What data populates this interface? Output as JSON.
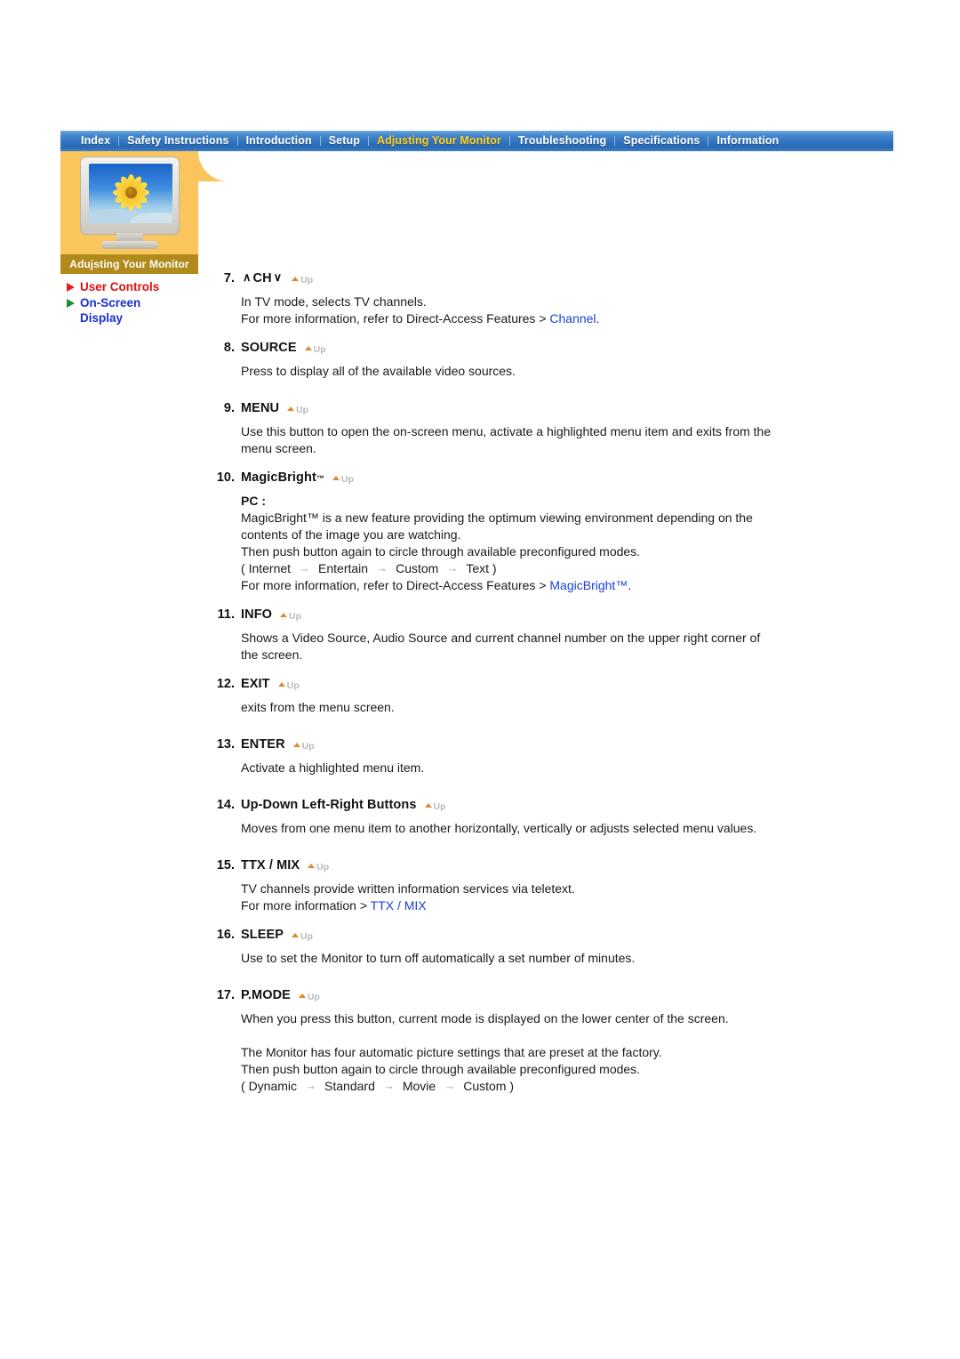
{
  "nav": {
    "items": [
      {
        "label": "Index",
        "active": false
      },
      {
        "label": "Safety Instructions",
        "active": false
      },
      {
        "label": "Introduction",
        "active": false
      },
      {
        "label": "Setup",
        "active": false
      },
      {
        "label": "Adjusting Your Monitor",
        "active": true
      },
      {
        "label": "Troubleshooting",
        "active": false
      },
      {
        "label": "Specifications",
        "active": false
      },
      {
        "label": "Information",
        "active": false
      }
    ],
    "active_color": "#ffcf1f",
    "bar_color": "#2f73c0"
  },
  "sidebar": {
    "card_caption": "Adujsting Your Monitor",
    "card_color": "#fbc55d",
    "caption_color": "#b08a1b",
    "thumbnail_icon": "monitor-sunflower-image",
    "links": [
      {
        "label": "User Controls",
        "color": "#e01010",
        "bullet_color": "#e01f1f"
      },
      {
        "label": "On-Screen Display",
        "color": "#1a2fd0",
        "bullet_color": "#15912b"
      }
    ]
  },
  "up_label": "Up",
  "content": {
    "items": [
      {
        "num": "7.",
        "title": "CH",
        "prefix_chevron": "∧",
        "suffix_chevron": "∨",
        "lines": [
          {
            "text": "In TV mode, selects TV channels."
          },
          {
            "text": "For more information, refer to Direct-Access Features > ",
            "link": "Channel",
            "after": "."
          }
        ]
      },
      {
        "num": "8.",
        "title": "SOURCE",
        "lines": [
          {
            "text": "Press to display all of the available video sources."
          }
        ]
      },
      {
        "num": "9.",
        "title": "MENU",
        "lines": [
          {
            "text": "Use this button to open the on-screen menu, activate a highlighted menu item and exits from the"
          },
          {
            "text": "menu screen."
          }
        ]
      },
      {
        "num": "10.",
        "title": "MagicBright",
        "trademark": "™",
        "sub_label": "PC :",
        "lines": [
          {
            "text": "MagicBright™ is a new feature providing the optimum viewing environment depending on the"
          },
          {
            "text": "contents of the image you are watching."
          },
          {
            "text": "Then push button again to circle through available preconfigured modes."
          }
        ],
        "mode_sequence": {
          "open": "(",
          "modes": [
            "Internet",
            "Entertain",
            "Custom",
            "Text"
          ],
          "close": ")",
          "arrow": "→"
        },
        "footer": {
          "text": "For more information, refer to Direct-Access Features > ",
          "link": "MagicBright™",
          "after": "."
        }
      },
      {
        "num": "11.",
        "title": "INFO",
        "lines": [
          {
            "text": "Shows a Video Source, Audio Source and current channel number on the upper right corner of"
          },
          {
            "text": "the screen."
          }
        ]
      },
      {
        "num": "12.",
        "title": "EXIT",
        "lines": [
          {
            "text": "exits from the menu screen."
          }
        ]
      },
      {
        "num": "13.",
        "title": "ENTER",
        "lines": [
          {
            "text": "Activate a highlighted menu item."
          }
        ]
      },
      {
        "num": "14.",
        "title": "Up-Down Left-Right Buttons",
        "lines": [
          {
            "text": "Moves from one menu item to another horizontally, vertically or adjusts selected menu values."
          }
        ]
      },
      {
        "num": "15.",
        "title": "TTX / MIX",
        "lines": [
          {
            "text": "TV channels provide written information services via teletext."
          },
          {
            "text": "For more information > ",
            "link": "TTX / MIX",
            "after": ""
          }
        ]
      },
      {
        "num": "16.",
        "title": "SLEEP",
        "lines": [
          {
            "text": "Use to set the Monitor to turn off automatically a set number of minutes."
          }
        ]
      },
      {
        "num": "17.",
        "title": "P.MODE",
        "lines": [
          {
            "text": "When you press this button, current mode is displayed on the lower center of the screen."
          },
          {
            "text": ""
          },
          {
            "text": "The Monitor has four automatic picture settings that are preset at the factory."
          },
          {
            "text": "Then push button again to circle through available preconfigured modes."
          }
        ],
        "mode_sequence": {
          "open": "(",
          "modes": [
            "Dynamic",
            "Standard",
            "Movie",
            "Custom"
          ],
          "close": ")",
          "arrow": "→"
        }
      }
    ]
  }
}
